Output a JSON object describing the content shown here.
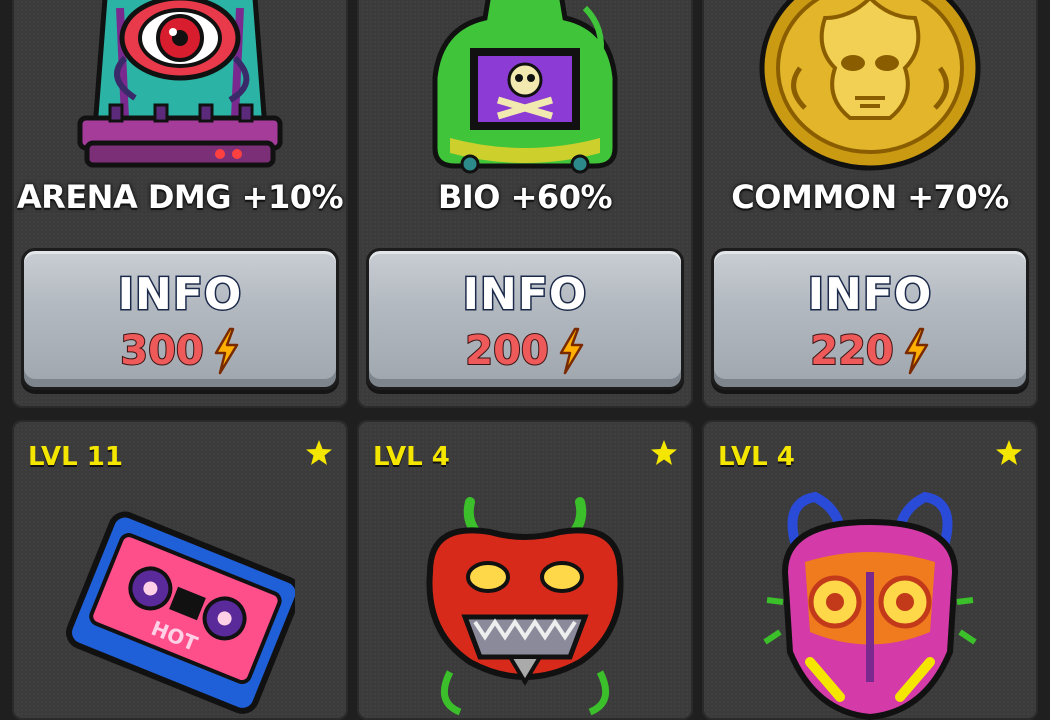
{
  "top_row": [
    {
      "bonus": "ARENA DMG +10%",
      "button_label": "INFO",
      "price": "300",
      "art_icon": "eye-in-jar-icon"
    },
    {
      "bonus": "BIO +60%",
      "button_label": "INFO",
      "price": "200",
      "art_icon": "poison-jar-icon"
    },
    {
      "bonus": "COMMON +70%",
      "button_label": "INFO",
      "price": "220",
      "art_icon": "gold-coin-icon"
    }
  ],
  "bottom_row": [
    {
      "level": "LVL 11",
      "art_icon": "cassette-tape-icon",
      "tape_text": "HOT"
    },
    {
      "level": "LVL 4",
      "art_icon": "pepper-mask-icon"
    },
    {
      "level": "LVL 4",
      "art_icon": "bug-mask-icon"
    }
  ],
  "colors": {
    "price": "#ee5a5a",
    "level": "#f5e600",
    "star": "#f5e600",
    "energy": "#ffb000"
  }
}
